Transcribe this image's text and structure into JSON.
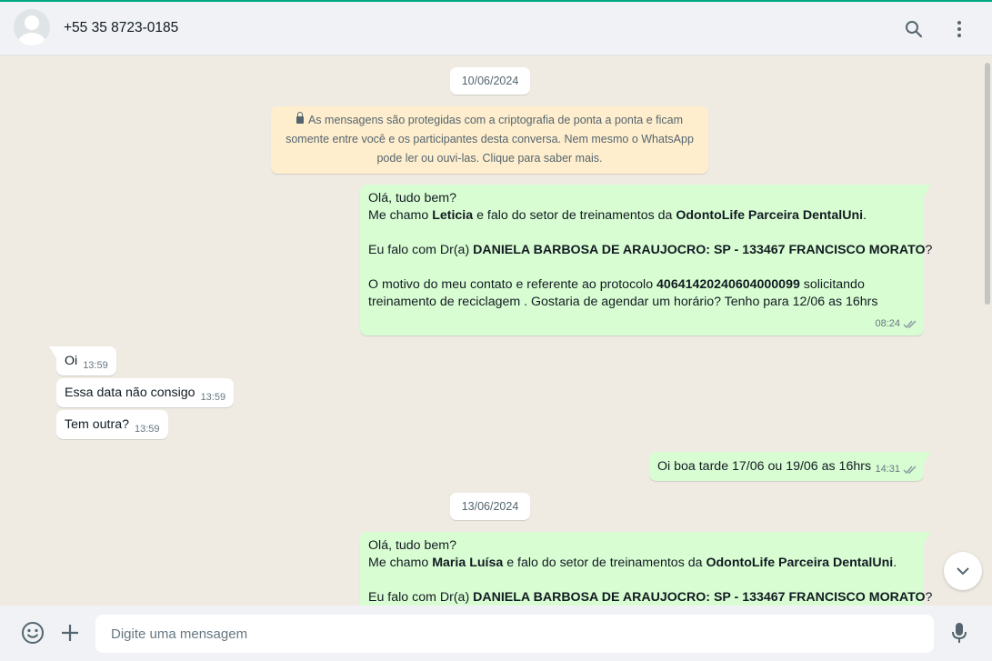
{
  "header": {
    "contact": "+55 35 8723-0185",
    "icons": [
      "avatar",
      "search-icon",
      "menu-icon"
    ]
  },
  "chat": {
    "date1": "10/06/2024",
    "encryption": {
      "line1": "As mensagens são protegidas com a criptografia de ponta a ponta e ficam",
      "line2": "somente entre você e os participantes desta conversa. Nem mesmo o WhatsApp",
      "line3": "pode ler ou ouvi-las. Clique para saber mais."
    },
    "msg1": {
      "l1": "Olá, tudo bem?",
      "l2a": "Me chamo ",
      "l2b": "Leticia",
      "l2c": " e falo do setor de treinamentos  da ",
      "l2d": "OdontoLife Parceira DentalUni",
      "l2e": ".",
      "l3a": " Eu falo com Dr(a) ",
      "l3b": "DANIELA BARBOSA DE ARAUJOCRO: SP - 133467 FRANCISCO MORATO",
      "l3c": "?",
      "l4a": "O motivo do meu contato e referente ao protocolo ",
      "l4b": "40641420240604000099",
      "l4c": " solicitando",
      "l5": "treinamento de reciclagem . Gostaria de agendar um horário?   Tenho para 12/06 as 16hrs",
      "time": "08:24"
    },
    "in1": {
      "text": "Oi",
      "time": "13:59"
    },
    "in2": {
      "text": "Essa data não consigo",
      "time": "13:59"
    },
    "in3": {
      "text": "Tem outra?",
      "time": "13:59"
    },
    "out2": {
      "text": "Oi boa tarde 17/06 ou 19/06 as 16hrs",
      "time": "14:31"
    },
    "date2": "13/06/2024",
    "msg2": {
      "l1": "Olá, tudo bem?",
      "l2a": "Me chamo ",
      "l2b": "Maria Luísa",
      "l2c": " e falo do setor de treinamentos  da ",
      "l2d": "OdontoLife Parceira DentalUni",
      "l2e": ".",
      "l3a": " Eu falo com Dr(a) ",
      "l3b": "DANIELA BARBOSA DE ARAUJOCRO: SP - 133467 FRANCISCO MORATO",
      "l3c": "?"
    }
  },
  "footer": {
    "placeholder": "Digite uma mensagem",
    "icons": [
      "emoji-icon",
      "plus-icon",
      "mic-icon"
    ]
  },
  "colors": {
    "outgoing": "#d9fdd3",
    "incoming": "#ffffff",
    "encryption_bg": "#ffeecd",
    "chat_bg": "#efeae2",
    "accent": "#00a884"
  }
}
